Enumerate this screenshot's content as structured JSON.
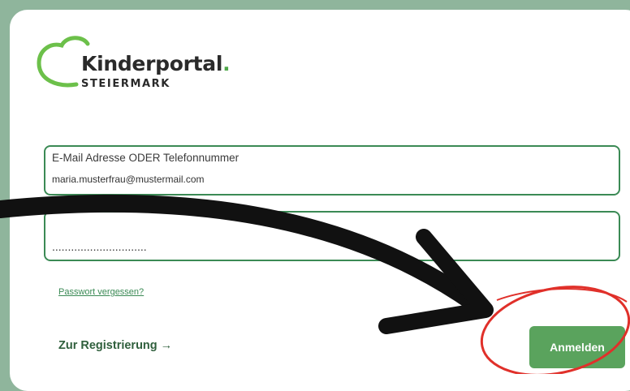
{
  "logo": {
    "wordmark": "Kinderportal",
    "dot": ".",
    "subtitle": "STEIERMARK"
  },
  "form": {
    "email_label": "E-Mail Adresse ODER Telefonnummer",
    "email_value": "maria.musterfrau@mustermail.com",
    "password_value": "..............................",
    "forgot_link": "Passwort vergessen?",
    "register_link": "Zur Registrierung →",
    "submit_label": "Anmelden"
  },
  "colors": {
    "accent": "#3b8a55",
    "button": "#5aa35d",
    "background": "#8fb59c",
    "annotation_circle": "#e0302a",
    "annotation_arrow": "#111111"
  },
  "annotations": {
    "arrow_icon": "curved-arrow-icon",
    "circle_icon": "highlight-circle-icon"
  }
}
